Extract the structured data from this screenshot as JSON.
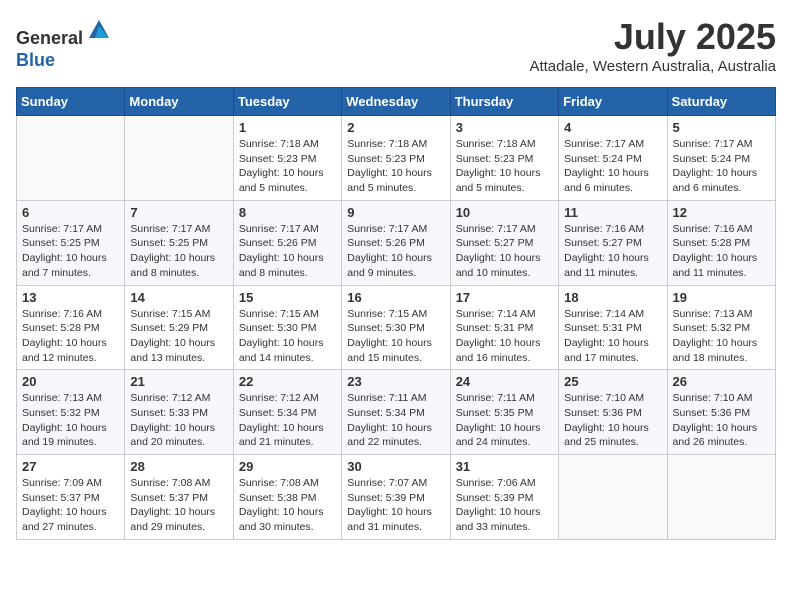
{
  "header": {
    "logo_general": "General",
    "logo_blue": "Blue",
    "month_year": "July 2025",
    "location": "Attadale, Western Australia, Australia"
  },
  "weekdays": [
    "Sunday",
    "Monday",
    "Tuesday",
    "Wednesday",
    "Thursday",
    "Friday",
    "Saturday"
  ],
  "weeks": [
    [
      {
        "day": "",
        "info": ""
      },
      {
        "day": "",
        "info": ""
      },
      {
        "day": "1",
        "info": "Sunrise: 7:18 AM\nSunset: 5:23 PM\nDaylight: 10 hours and 5 minutes."
      },
      {
        "day": "2",
        "info": "Sunrise: 7:18 AM\nSunset: 5:23 PM\nDaylight: 10 hours and 5 minutes."
      },
      {
        "day": "3",
        "info": "Sunrise: 7:18 AM\nSunset: 5:23 PM\nDaylight: 10 hours and 5 minutes."
      },
      {
        "day": "4",
        "info": "Sunrise: 7:17 AM\nSunset: 5:24 PM\nDaylight: 10 hours and 6 minutes."
      },
      {
        "day": "5",
        "info": "Sunrise: 7:17 AM\nSunset: 5:24 PM\nDaylight: 10 hours and 6 minutes."
      }
    ],
    [
      {
        "day": "6",
        "info": "Sunrise: 7:17 AM\nSunset: 5:25 PM\nDaylight: 10 hours and 7 minutes."
      },
      {
        "day": "7",
        "info": "Sunrise: 7:17 AM\nSunset: 5:25 PM\nDaylight: 10 hours and 8 minutes."
      },
      {
        "day": "8",
        "info": "Sunrise: 7:17 AM\nSunset: 5:26 PM\nDaylight: 10 hours and 8 minutes."
      },
      {
        "day": "9",
        "info": "Sunrise: 7:17 AM\nSunset: 5:26 PM\nDaylight: 10 hours and 9 minutes."
      },
      {
        "day": "10",
        "info": "Sunrise: 7:17 AM\nSunset: 5:27 PM\nDaylight: 10 hours and 10 minutes."
      },
      {
        "day": "11",
        "info": "Sunrise: 7:16 AM\nSunset: 5:27 PM\nDaylight: 10 hours and 11 minutes."
      },
      {
        "day": "12",
        "info": "Sunrise: 7:16 AM\nSunset: 5:28 PM\nDaylight: 10 hours and 11 minutes."
      }
    ],
    [
      {
        "day": "13",
        "info": "Sunrise: 7:16 AM\nSunset: 5:28 PM\nDaylight: 10 hours and 12 minutes."
      },
      {
        "day": "14",
        "info": "Sunrise: 7:15 AM\nSunset: 5:29 PM\nDaylight: 10 hours and 13 minutes."
      },
      {
        "day": "15",
        "info": "Sunrise: 7:15 AM\nSunset: 5:30 PM\nDaylight: 10 hours and 14 minutes."
      },
      {
        "day": "16",
        "info": "Sunrise: 7:15 AM\nSunset: 5:30 PM\nDaylight: 10 hours and 15 minutes."
      },
      {
        "day": "17",
        "info": "Sunrise: 7:14 AM\nSunset: 5:31 PM\nDaylight: 10 hours and 16 minutes."
      },
      {
        "day": "18",
        "info": "Sunrise: 7:14 AM\nSunset: 5:31 PM\nDaylight: 10 hours and 17 minutes."
      },
      {
        "day": "19",
        "info": "Sunrise: 7:13 AM\nSunset: 5:32 PM\nDaylight: 10 hours and 18 minutes."
      }
    ],
    [
      {
        "day": "20",
        "info": "Sunrise: 7:13 AM\nSunset: 5:32 PM\nDaylight: 10 hours and 19 minutes."
      },
      {
        "day": "21",
        "info": "Sunrise: 7:12 AM\nSunset: 5:33 PM\nDaylight: 10 hours and 20 minutes."
      },
      {
        "day": "22",
        "info": "Sunrise: 7:12 AM\nSunset: 5:34 PM\nDaylight: 10 hours and 21 minutes."
      },
      {
        "day": "23",
        "info": "Sunrise: 7:11 AM\nSunset: 5:34 PM\nDaylight: 10 hours and 22 minutes."
      },
      {
        "day": "24",
        "info": "Sunrise: 7:11 AM\nSunset: 5:35 PM\nDaylight: 10 hours and 24 minutes."
      },
      {
        "day": "25",
        "info": "Sunrise: 7:10 AM\nSunset: 5:36 PM\nDaylight: 10 hours and 25 minutes."
      },
      {
        "day": "26",
        "info": "Sunrise: 7:10 AM\nSunset: 5:36 PM\nDaylight: 10 hours and 26 minutes."
      }
    ],
    [
      {
        "day": "27",
        "info": "Sunrise: 7:09 AM\nSunset: 5:37 PM\nDaylight: 10 hours and 27 minutes."
      },
      {
        "day": "28",
        "info": "Sunrise: 7:08 AM\nSunset: 5:37 PM\nDaylight: 10 hours and 29 minutes."
      },
      {
        "day": "29",
        "info": "Sunrise: 7:08 AM\nSunset: 5:38 PM\nDaylight: 10 hours and 30 minutes."
      },
      {
        "day": "30",
        "info": "Sunrise: 7:07 AM\nSunset: 5:39 PM\nDaylight: 10 hours and 31 minutes."
      },
      {
        "day": "31",
        "info": "Sunrise: 7:06 AM\nSunset: 5:39 PM\nDaylight: 10 hours and 33 minutes."
      },
      {
        "day": "",
        "info": ""
      },
      {
        "day": "",
        "info": ""
      }
    ]
  ]
}
